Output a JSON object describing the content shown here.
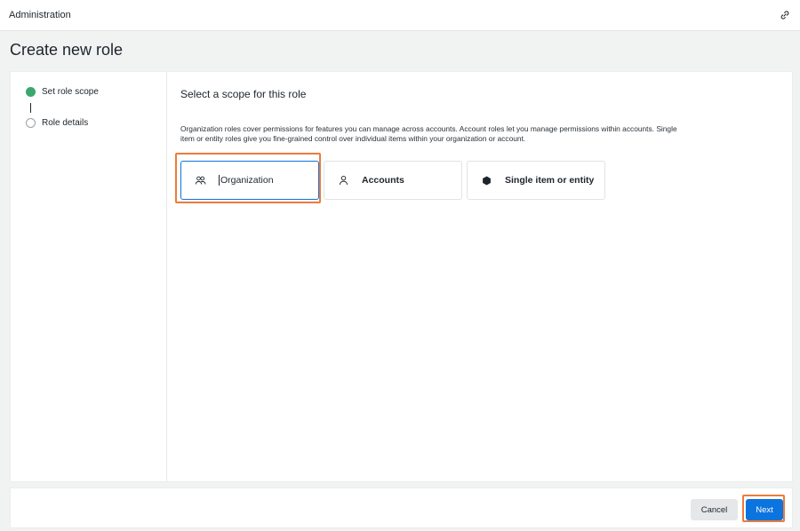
{
  "header": {
    "app_title": "Administration",
    "link_icon": "link-icon"
  },
  "page": {
    "title": "Create new role"
  },
  "steps": [
    {
      "label": "Set role scope",
      "status": "complete"
    },
    {
      "label": "Role details",
      "status": "pending"
    }
  ],
  "scope": {
    "heading": "Select a scope for this role",
    "description": "Organization roles cover permissions for features you can manage across accounts. Account roles let you manage permissions within accounts. Single item or entity roles give you fine-grained control over individual items within your organization or account.",
    "options": [
      {
        "label": "Organization",
        "icon": "organization-icon",
        "selected": true
      },
      {
        "label": "Accounts",
        "icon": "user-icon",
        "selected": false
      },
      {
        "label": "Single item or entity",
        "icon": "hexagon-icon",
        "selected": false
      }
    ]
  },
  "footer": {
    "cancel_label": "Cancel",
    "next_label": "Next"
  },
  "colors": {
    "accent": "#0c74df",
    "step_complete": "#3aa86b",
    "highlight": "#ec7b3c"
  }
}
